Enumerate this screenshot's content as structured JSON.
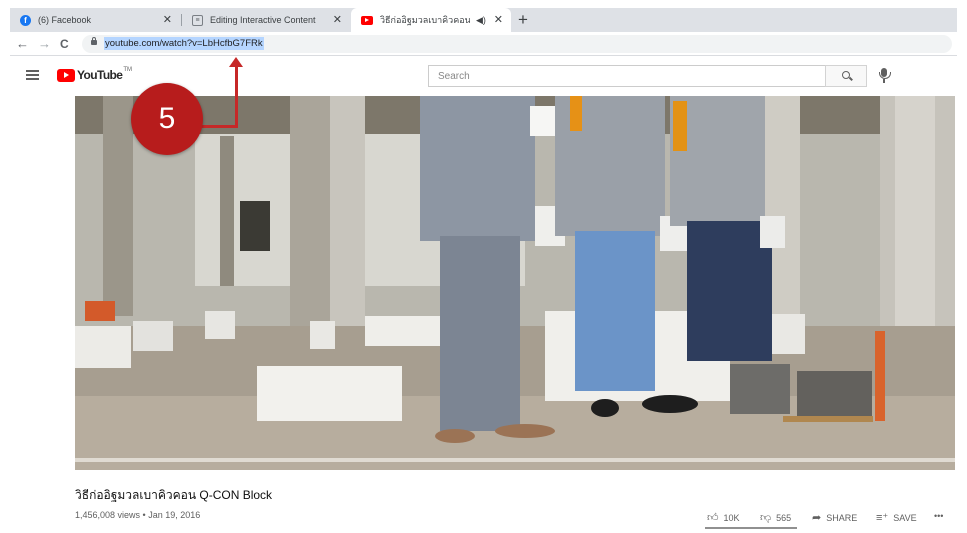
{
  "browser": {
    "tabs": [
      {
        "icon": "facebook-icon",
        "label": "(6) Facebook"
      },
      {
        "icon": "document-icon",
        "label": "Editing Interactive Content"
      },
      {
        "icon": "youtube-icon",
        "label": "วิธีก่ออิฐมวลเบาคิวคอน Q-CON",
        "audio_indicator": "◀)"
      }
    ],
    "close_glyph": "✕",
    "new_tab_glyph": "+",
    "back_glyph": "←",
    "forward_glyph": "→",
    "reload_glyph": "C",
    "url": "youtube.com/watch?v=LbHcfbG7FRk"
  },
  "youtube": {
    "logo_text": "YouTube",
    "logo_tm": "TM",
    "search_placeholder": "Search"
  },
  "callout": {
    "number": "5",
    "color": "#b71c1c"
  },
  "video": {
    "title": "วิธีก่ออิฐมวลเบาคิวคอน Q-CON Block",
    "views_date": "1,456,008 views • Jan 19, 2016",
    "likes": "10K",
    "dislikes": "565",
    "share_label": "SHARE",
    "save_label": "SAVE",
    "more_glyph": "•••"
  },
  "colors": {
    "brand_red": "#ff0000",
    "url_highlight": "#b5d5ff",
    "tab_strip": "#dee1e6"
  }
}
